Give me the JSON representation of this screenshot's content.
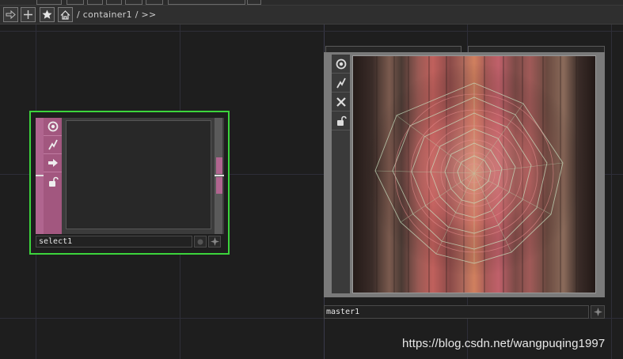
{
  "toolbar": {
    "path": "/ container1 / >>",
    "buttons": [
      {
        "name": "forward",
        "icon": "arrow-right-icon"
      },
      {
        "name": "add",
        "icon": "plus-icon"
      },
      {
        "name": "favorite",
        "icon": "star-icon"
      },
      {
        "name": "home",
        "icon": "home-icon"
      }
    ]
  },
  "nodes": {
    "select": {
      "label": "select1",
      "color": "#b0658f",
      "selected_outline": "#3cd43c",
      "icons": [
        "viewer-icon",
        "bypass-icon",
        "export-icon",
        "lock-icon"
      ]
    },
    "master": {
      "label": "master1",
      "icons": [
        "viewer-icon",
        "bypass-icon",
        "close-icon",
        "lock-icon"
      ]
    }
  },
  "watermark": "https://blog.csdn.net/wangpuqing1997"
}
